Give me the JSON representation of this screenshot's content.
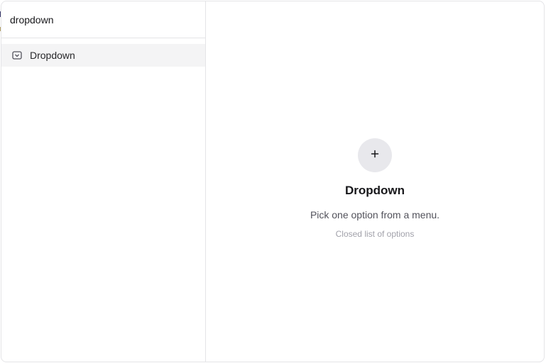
{
  "search": {
    "value": "dropdown"
  },
  "list": {
    "items": [
      {
        "label": "Dropdown",
        "icon": "dropdown-box-icon"
      }
    ]
  },
  "detail": {
    "icon": "plus-icon",
    "title": "Dropdown",
    "description": "Pick one option from a menu.",
    "subtitle": "Closed list of options"
  }
}
